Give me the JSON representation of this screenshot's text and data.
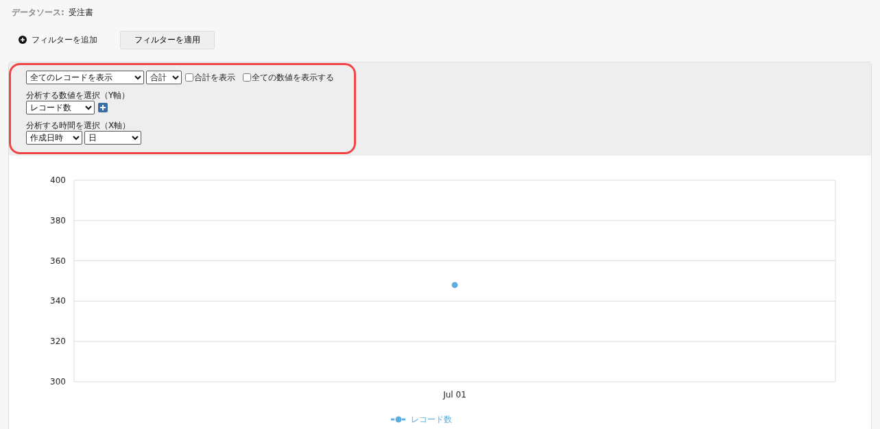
{
  "data_source": {
    "label": "データソース:",
    "value": "受注書"
  },
  "filter_bar": {
    "add_filter": "フィルターを追加",
    "apply_button": "フィルターを適用"
  },
  "settings": {
    "record_select": "全てのレコードを表示",
    "aggregate_select": "合計",
    "checkboxes": [
      {
        "label": "合計を表示",
        "checked": false
      },
      {
        "label": "全ての数値を表示する",
        "checked": false
      }
    ],
    "y_axis": {
      "label": "分析する数値を選択（Y軸）",
      "select": "レコード数"
    },
    "x_axis": {
      "label": "分析する時間を選択（X軸）",
      "field_select": "作成日時",
      "unit_select": "日"
    }
  },
  "chart": {
    "chart_data": {
      "type": "line",
      "categories": [
        "Jul 01"
      ],
      "series": [
        {
          "name": "レコード数",
          "color": "#5dade2",
          "values": [
            348
          ]
        }
      ],
      "ylim": [
        300,
        400
      ],
      "grid": true,
      "marker": true,
      "yticks": [
        300,
        320,
        340,
        360,
        380,
        400
      ]
    }
  }
}
